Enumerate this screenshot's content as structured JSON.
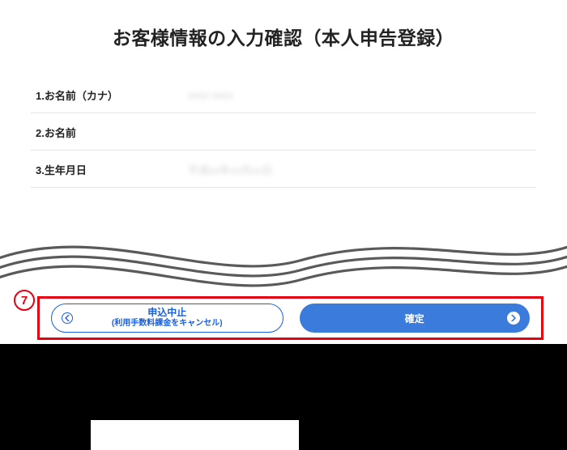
{
  "title": "お客様情報の入力確認（本人申告登録）",
  "rows": [
    {
      "label": "1.お名前（カナ）",
      "value": "xxxx xxxx"
    },
    {
      "label": "2.お名前",
      "value": ""
    },
    {
      "label": "3.生年月日",
      "value": "平成xx年xx月xx日"
    }
  ],
  "step_marker": "7",
  "cancel": {
    "main": "申込中止",
    "sub": "(利用手数料課金をキャンセル)"
  },
  "confirm": {
    "label": "確定"
  }
}
